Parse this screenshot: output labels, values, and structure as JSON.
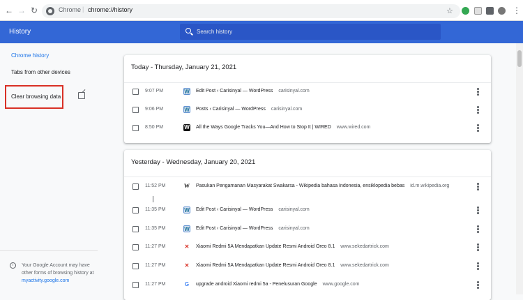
{
  "browser": {
    "site_label": "Chrome",
    "url": "chrome://history"
  },
  "header": {
    "title": "History",
    "search_placeholder": "Search history"
  },
  "sidebar": {
    "items": [
      {
        "label": "Chrome history"
      },
      {
        "label": "Tabs from other devices"
      },
      {
        "label": "Clear browsing data"
      }
    ],
    "footer": {
      "text": "Your Google Account may have other forms of browsing history at",
      "link": "myactivity.google.com"
    }
  },
  "groups": [
    {
      "title": "Today - Thursday, January 21, 2021",
      "entries": [
        {
          "time": "9:07 PM",
          "title": "Edit Post ‹ Carisinyal — WordPress",
          "domain": "carisinyal.com",
          "favicon": "wordpress-icon"
        },
        {
          "time": "9:06 PM",
          "title": "Posts ‹ Carisinyal — WordPress",
          "domain": "carisinyal.com",
          "favicon": "wordpress-icon"
        },
        {
          "time": "8:50 PM",
          "title": "All the Ways Google Tracks You—And How to Stop It | WIRED",
          "domain": "www.wired.com",
          "favicon": "wired-icon"
        }
      ]
    },
    {
      "title": "Yesterday - Wednesday, January 20, 2021",
      "entries": [
        {
          "time": "11:52 PM",
          "title": "Pasukan Pengamanan Masyarakat Swakarsa - Wikipedia bahasa Indonesia, ensiklopedia bebas",
          "domain": "id.m.wikipedia.org",
          "favicon": "wikipedia-icon"
        },
        {
          "time": "11:35 PM",
          "title": "Edit Post ‹ Carisinyal — WordPress",
          "domain": "carisinyal.com",
          "favicon": "wordpress-icon"
        },
        {
          "time": "11:35 PM",
          "title": "Edit Post ‹ Carisinyal — WordPress",
          "domain": "carisinyal.com",
          "favicon": "wordpress-icon"
        },
        {
          "time": "11:27 PM",
          "title": "Xiaomi Redmi 5A Mendapatkan Update Resmi Android Oreo 8.1",
          "domain": "www.sekedartrick.com",
          "favicon": "sekedartrick-icon"
        },
        {
          "time": "11:27 PM",
          "title": "Xiaomi Redmi 5A Mendapatkan Update Resmi Android Oreo 8.1",
          "domain": "www.sekedartrick.com",
          "favicon": "sekedartrick-icon"
        },
        {
          "time": "11:27 PM",
          "title": "upgrade android Xiaomi redmi 5a - Penelusuran Google",
          "domain": "www.google.com",
          "favicon": "google-icon"
        }
      ]
    }
  ],
  "colors": {
    "header": "#3367d6",
    "accent": "#1a73e8",
    "highlight_box": "#d93025"
  }
}
